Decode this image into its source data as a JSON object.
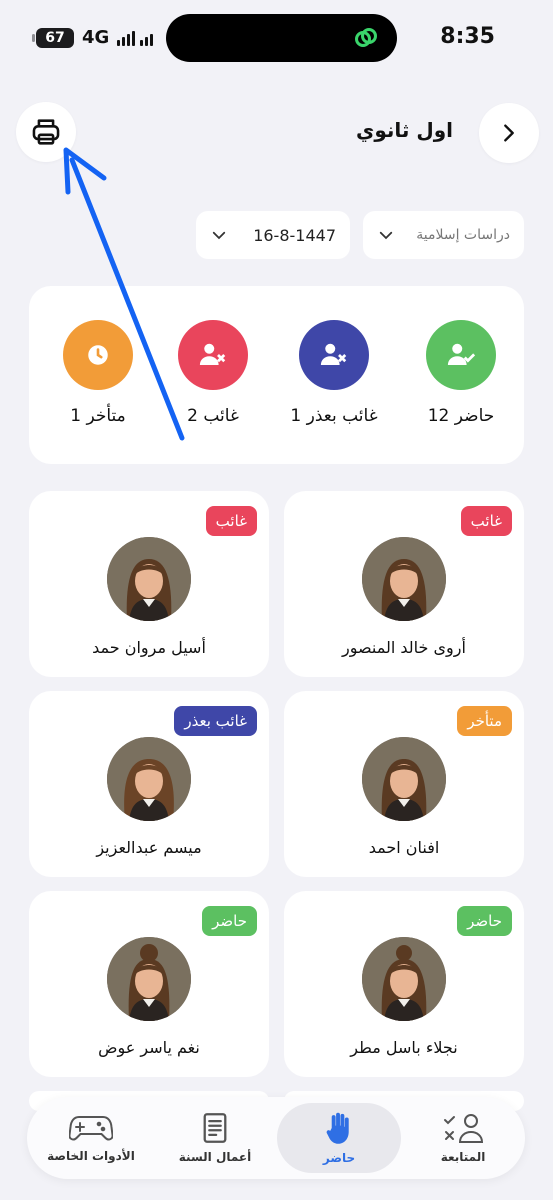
{
  "status_bar": {
    "battery": "67",
    "network": "4G",
    "time": "8:35"
  },
  "header": {
    "title": "اول ثانوي"
  },
  "filters": {
    "date": "16-8-1447",
    "subject": "دراسات إسلامية"
  },
  "summary": {
    "present": "12 حاضر",
    "absent_excused": "1 غائب بعذر",
    "absent": "2 غائب",
    "late": "1 متأخر"
  },
  "students": [
    {
      "name": "أروى خالد المنصور",
      "status": "غائب",
      "status_color": "#e9455c"
    },
    {
      "name": "أسيل مروان حمد",
      "status": "غائب",
      "status_color": "#e9455c"
    },
    {
      "name": "افنان احمد",
      "status": "متأخر",
      "status_color": "#f29c38"
    },
    {
      "name": "ميسم عبدالعزيز",
      "status": "غائب بعذر",
      "status_color": "#3f47a8"
    },
    {
      "name": "نجلاء باسل مطر",
      "status": "حاضر",
      "status_color": "#5cc061"
    },
    {
      "name": "نغم ياسر عوض",
      "status": "حاضر",
      "status_color": "#5cc061"
    }
  ],
  "nav": {
    "follow_up": "المتابعة",
    "attendance": "حاضر",
    "year_work": "أعمال السنة",
    "tools": "الأدوات الخاصة"
  },
  "colors": {
    "present": "#5cc061",
    "absent_excused": "#3f47a8",
    "absent": "#e9455c",
    "late": "#f29c38",
    "accent": "#2f6fe4",
    "annotation_arrow": "#1463f3"
  }
}
